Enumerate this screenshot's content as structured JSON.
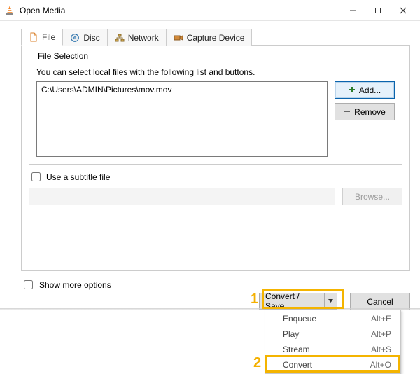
{
  "window": {
    "title": "Open Media"
  },
  "tabs": {
    "file": {
      "label": "File"
    },
    "disc": {
      "label": "Disc"
    },
    "network": {
      "label": "Network"
    },
    "capture": {
      "label": "Capture Device"
    }
  },
  "file_selection": {
    "group_label": "File Selection",
    "help": "You can select local files with the following list and buttons.",
    "files": [
      "C:\\Users\\ADMIN\\Pictures\\mov.mov"
    ],
    "add_label": "Add...",
    "remove_label": "Remove"
  },
  "subtitle": {
    "checkbox_label": "Use a subtitle file",
    "browse_label": "Browse..."
  },
  "show_more_label": "Show more options",
  "actions": {
    "convert_save_label": "Convert / Save",
    "cancel_label": "Cancel"
  },
  "dropdown": {
    "items": [
      {
        "label": "Enqueue",
        "shortcut": "Alt+E"
      },
      {
        "label": "Play",
        "shortcut": "Alt+P"
      },
      {
        "label": "Stream",
        "shortcut": "Alt+S"
      },
      {
        "label": "Convert",
        "shortcut": "Alt+O"
      }
    ]
  },
  "annotations": {
    "one": "1",
    "two": "2"
  }
}
